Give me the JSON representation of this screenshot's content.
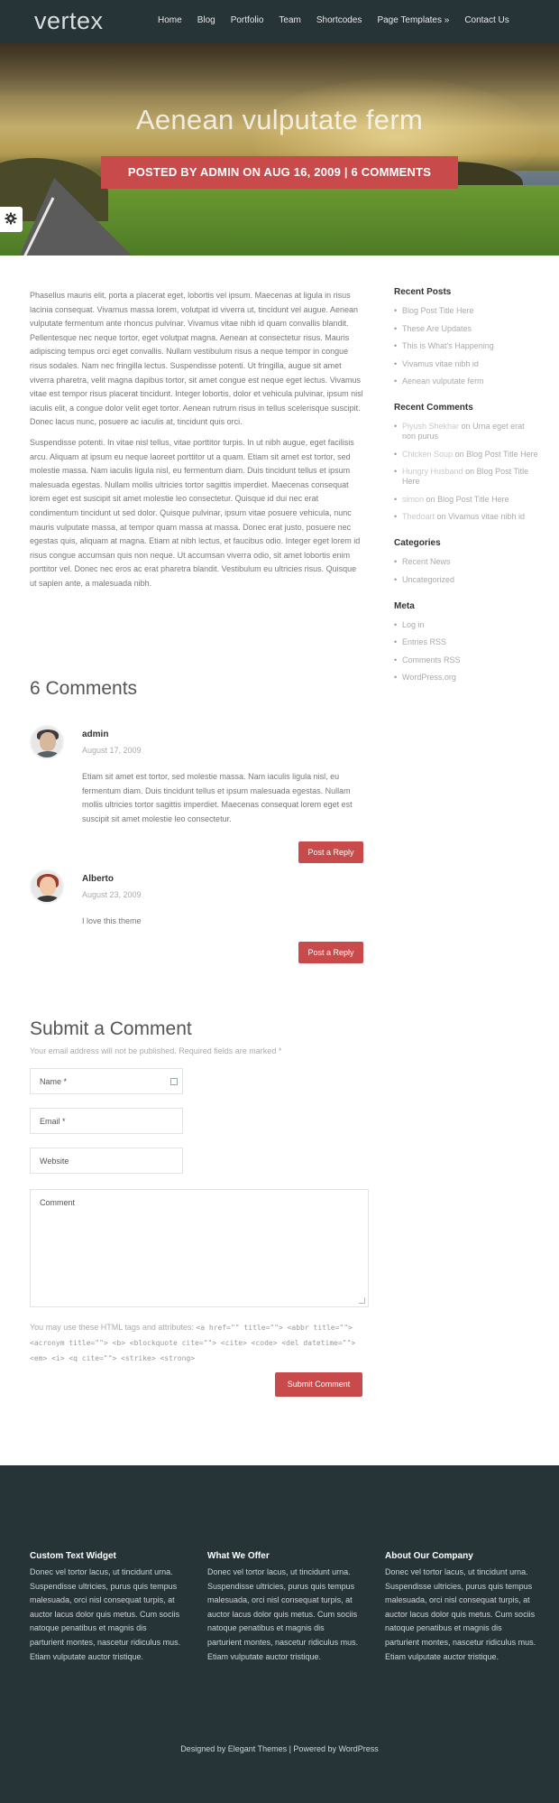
{
  "header": {
    "logo": "vertex",
    "nav": [
      "Home",
      "Blog",
      "Portfolio",
      "Team",
      "Shortcodes",
      "Page Templates »",
      "Contact Us"
    ]
  },
  "hero": {
    "title": "Aenean vulputate ferm",
    "meta": "POSTED BY ADMIN ON AUG 16, 2009 | 6 COMMENTS"
  },
  "post": {
    "paragraphs": [
      "Phasellus mauris elit, porta a placerat eget, lobortis vel ipsum. Maecenas at ligula in risus lacinia consequat. Vivamus massa lorem, volutpat id viverra ut, tincidunt vel augue. Aenean vulputate fermentum ante rhoncus pulvinar. Vivamus vitae nibh id quam convallis blandit. Pellentesque nec neque tortor, eget volutpat magna. Aenean at consectetur risus. Mauris adipiscing tempus orci eget convallis. Nullam vestibulum risus a neque tempor in congue risus sodales. Nam nec fringilla lectus. Suspendisse potenti. Ut fringilla, augue sit amet viverra pharetra, velit magna dapibus tortor, sit amet congue est neque eget lectus. Vivamus vitae est tempor risus placerat tincidunt. Integer lobortis, dolor et vehicula pulvinar, ipsum nisl iaculis elit, a congue dolor velit eget tortor. Aenean rutrum risus in tellus scelerisque suscipit. Donec lacus nunc, posuere ac iaculis at, tincidunt quis orci.",
      "Suspendisse potenti. In vitae nisl tellus, vitae porttitor turpis. In ut nibh augue, eget facilisis arcu. Aliquam at ipsum eu neque laoreet porttitor ut a quam. Etiam sit amet est tortor, sed molestie massa. Nam iaculis ligula nisl, eu fermentum diam. Duis tincidunt tellus et ipsum malesuada egestas. Nullam mollis ultricies tortor sagittis imperdiet. Maecenas consequat lorem eget est suscipit sit amet molestie leo consectetur. Quisque id dui nec erat condimentum tincidunt ut sed dolor. Quisque pulvinar, ipsum vitae posuere vehicula, nunc mauris vulputate massa, at tempor quam massa at massa. Donec erat justo, posuere nec egestas quis, aliquam at magna. Etiam at nibh lectus, et faucibus odio. Integer eget lorem id risus congue accumsan quis non neque. Ut accumsan viverra odio, sit amet lobortis enim porttitor vel. Donec nec eros ac erat pharetra blandit. Vestibulum eu ultricies risus. Quisque ut sapien ante, a malesuada nibh."
    ]
  },
  "sidebar": {
    "recent_posts": {
      "title": "Recent Posts",
      "items": [
        "Blog Post Title Here",
        "These Are Updates",
        "This is What's Happening",
        "Vivamus vitae nibh id",
        "Aenean vulputate ferm"
      ]
    },
    "recent_comments": {
      "title": "Recent Comments",
      "items": [
        {
          "author": "Piyush Shekhar",
          "on": "on",
          "post": "Urna eget erat non purus"
        },
        {
          "author": "Chicken Soup",
          "on": "on",
          "post": "Blog Post Title Here"
        },
        {
          "author": "Hungry Husband",
          "on": "on",
          "post": "Blog Post Title Here"
        },
        {
          "author": "simon",
          "on": "on",
          "post": "Blog Post Title Here"
        },
        {
          "author": "Thedoart",
          "on": "on",
          "post": "Vivamus vitae nibh id"
        }
      ]
    },
    "categories": {
      "title": "Categories",
      "items": [
        "Recent News",
        "Uncategorized"
      ]
    },
    "meta": {
      "title": "Meta",
      "items": [
        "Log in",
        "Entries RSS",
        "Comments RSS",
        "WordPress.org"
      ]
    }
  },
  "comments": {
    "title": "6 Comments",
    "items": [
      {
        "author": "admin",
        "date": "August 17, 2009",
        "text": "Etiam sit amet est tortor, sed molestie massa. Nam iaculis ligula nisl, eu fermentum diam. Duis tincidunt tellus et ipsum malesuada egestas. Nullam mollis ultricies tortor sagittis imperdiet. Maecenas consequat lorem eget est suscipit sit amet molestie leo consectetur.",
        "reply": "Post a Reply"
      },
      {
        "author": "Alberto",
        "date": "August 23, 2009",
        "text": "I love this theme",
        "reply": "Post a Reply"
      }
    ]
  },
  "form": {
    "title": "Submit a Comment",
    "note": "Your email address will not be published. Required fields are marked *",
    "name_placeholder": "Name *",
    "email_placeholder": "Email *",
    "website_placeholder": "Website",
    "comment_placeholder": "Comment",
    "allowed_intro": "You may use these HTML tags and attributes:",
    "allowed_tags": "<a href=\"\" title=\"\"> <abbr title=\"\"> <acronym title=\"\"> <b> <blockquote cite=\"\"> <cite> <code> <del datetime=\"\"> <em> <i> <q cite=\"\"> <strike> <strong>",
    "submit": "Submit Comment"
  },
  "footer": {
    "columns": [
      {
        "title": "Custom Text Widget",
        "text": "Donec vel tortor lacus, ut tincidunt urna. Suspendisse ultricies, purus quis tempus malesuada, orci nisl consequat turpis, at auctor lacus dolor quis metus. Cum sociis natoque penatibus et magnis dis parturient montes, nascetur ridiculus mus. Etiam vulputate auctor tristique."
      },
      {
        "title": "What We Offer",
        "text": "Donec vel tortor lacus, ut tincidunt urna. Suspendisse ultricies, purus quis tempus malesuada, orci nisl consequat turpis, at auctor lacus dolor quis metus. Cum sociis natoque penatibus et magnis dis parturient montes, nascetur ridiculus mus. Etiam vulputate auctor tristique."
      },
      {
        "title": "About Our Company",
        "text": "Donec vel tortor lacus, ut tincidunt urna. Suspendisse ultricies, purus quis tempus malesuada, orci nisl consequat turpis, at auctor lacus dolor quis metus. Cum sociis natoque penatibus et magnis dis parturient montes, nascetur ridiculus mus. Etiam vulputate auctor tristique."
      }
    ],
    "credits": "Designed by Elegant Themes | Powered by WordPress"
  },
  "colors": {
    "dark": "#263337",
    "accent": "#c94a4a"
  }
}
